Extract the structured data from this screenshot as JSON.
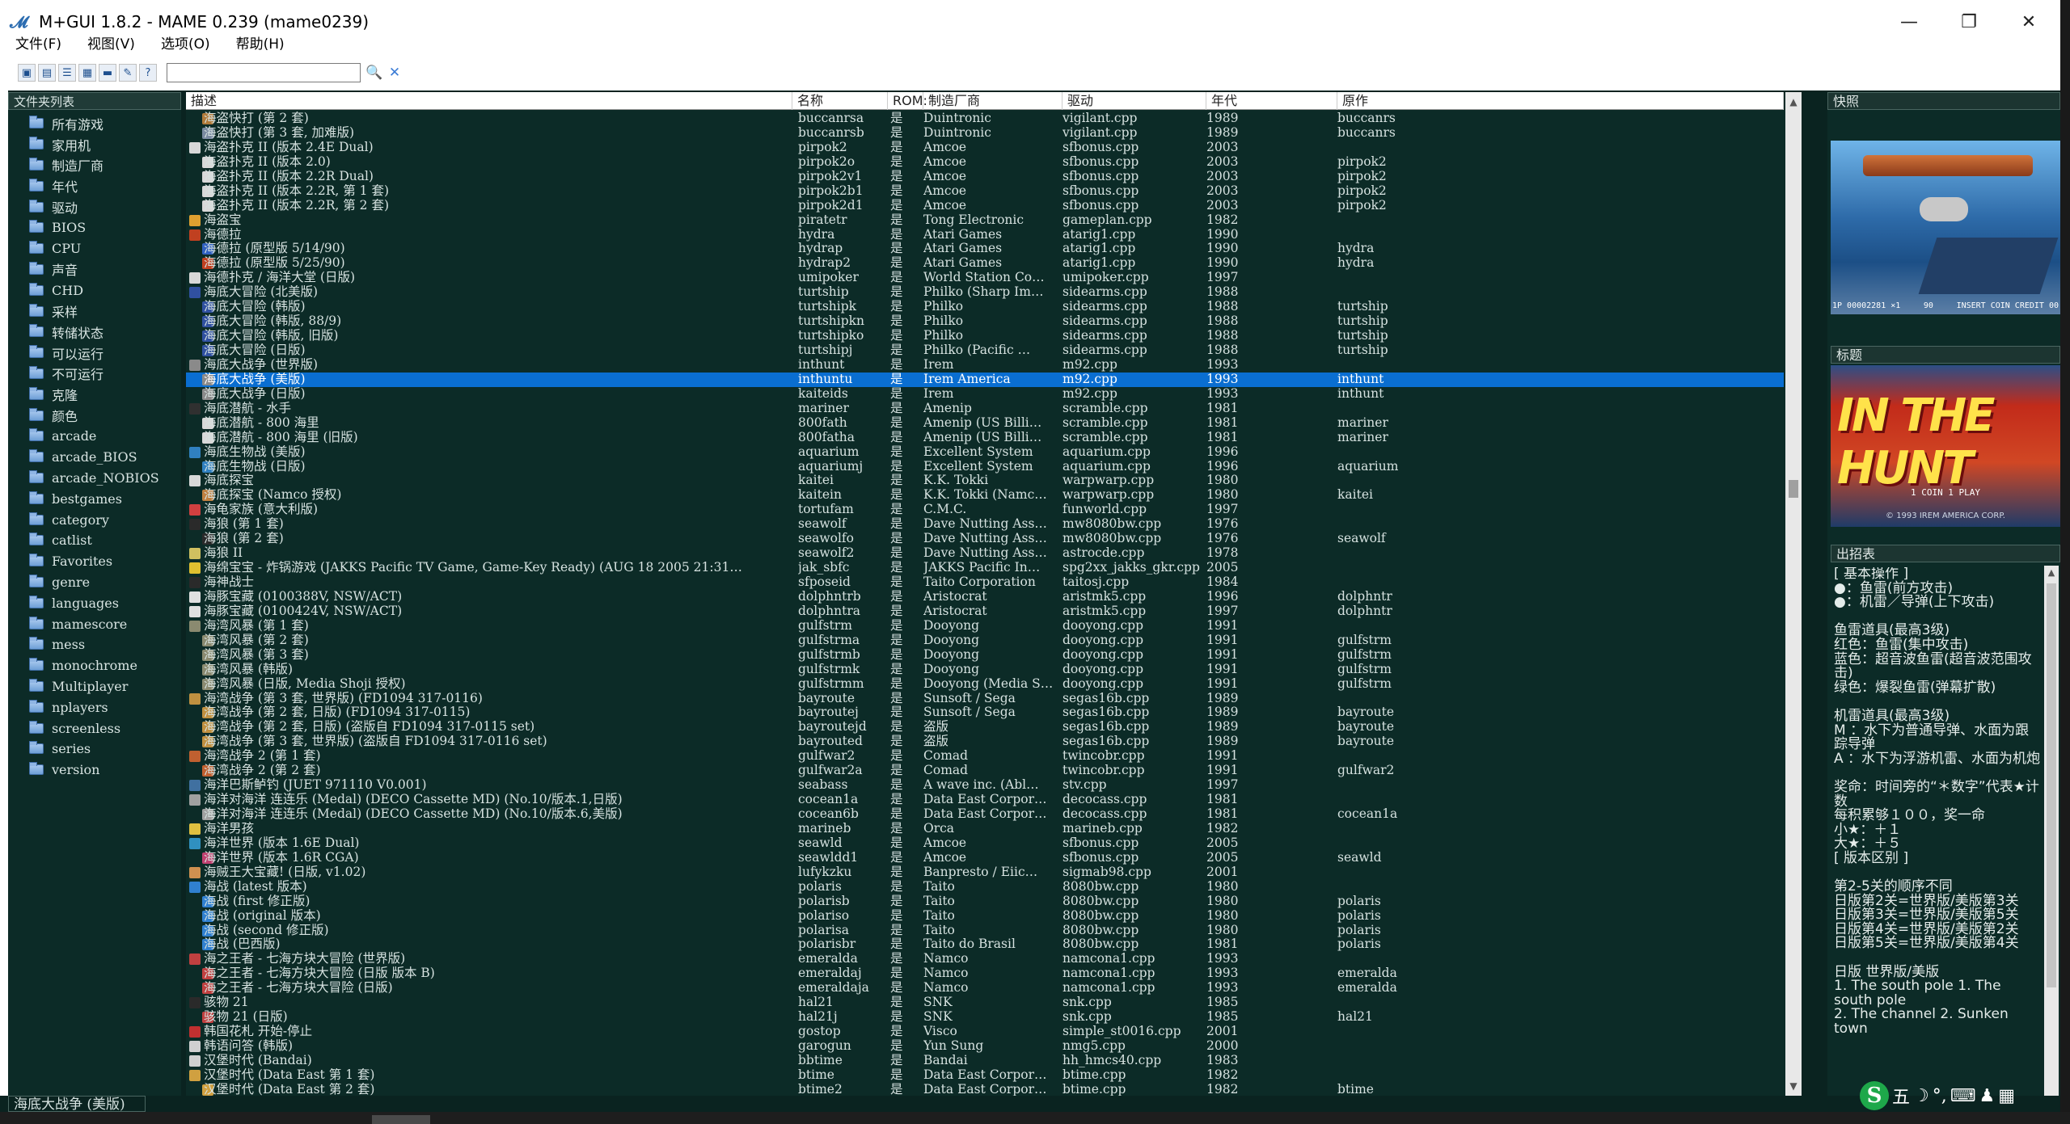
{
  "window": {
    "title": "M+GUI 1.8.2 - MAME 0.239 (mame0239)",
    "controls": {
      "minimize": "—",
      "maximize": "❐",
      "close": "✕"
    }
  },
  "menu": [
    "文件(F)",
    "视图(V)",
    "选项(O)",
    "帮助(H)"
  ],
  "toolbar": {
    "buttons": [
      "view-large-icons",
      "view-small-icons",
      "view-list",
      "view-details",
      "folder",
      "tools",
      "help"
    ],
    "search_value": "",
    "search_icon": "🔍",
    "clear_icon": "✕"
  },
  "folders": {
    "header": "文件夹列表",
    "items": [
      "所有游戏",
      "家用机",
      "制造厂商",
      "年代",
      "驱动",
      "BIOS",
      "CPU",
      "声音",
      "CHD",
      "采样",
      "转储状态",
      "可以运行",
      "不可运行",
      "克隆",
      "颜色",
      "arcade",
      "arcade_BIOS",
      "arcade_NOBIOS",
      "bestgames",
      "category",
      "catlist",
      "Favorites",
      "genre",
      "languages",
      "mamescore",
      "mess",
      "monochrome",
      "Multiplayer",
      "nplayers",
      "screenless",
      "series",
      "version"
    ]
  },
  "columns": {
    "desc": "描述",
    "name": "名称",
    "rom": "ROM:",
    "manu": "制造厂商",
    "driver": "驱动",
    "year": "年代",
    "parent": "原作"
  },
  "rows": [
    {
      "d": "　海盗快打 (第 2 套)",
      "n": "buccanrsa",
      "r": "是",
      "m": "Duintronic",
      "v": "vigilant.cpp",
      "y": "1989",
      "p": "buccanrs",
      "c": "#b07a3a"
    },
    {
      "d": "　海盗快打 (第 3 套, 加难版)",
      "n": "buccanrsb",
      "r": "是",
      "m": "Duintronic",
      "v": "vigilant.cpp",
      "y": "1989",
      "p": "buccanrs",
      "c": "#7a8aa0"
    },
    {
      "d": "海盗扑克 II (版本 2.4E Dual)",
      "n": "pirpok2",
      "r": "是",
      "m": "Amcoe",
      "v": "sfbonus.cpp",
      "y": "2003",
      "p": "",
      "c": "#d8d8d8"
    },
    {
      "d": "　海盗扑克 II (版本 2.0)",
      "n": "pirpok2o",
      "r": "是",
      "m": "Amcoe",
      "v": "sfbonus.cpp",
      "y": "2003",
      "p": "pirpok2",
      "c": "#d8d8d8"
    },
    {
      "d": "　海盗扑克 II (版本 2.2R Dual)",
      "n": "pirpok2v1",
      "r": "是",
      "m": "Amcoe",
      "v": "sfbonus.cpp",
      "y": "2003",
      "p": "pirpok2",
      "c": "#d8d8d8"
    },
    {
      "d": "　海盗扑克 II (版本 2.2R, 第 1 套)",
      "n": "pirpok2b1",
      "r": "是",
      "m": "Amcoe",
      "v": "sfbonus.cpp",
      "y": "2003",
      "p": "pirpok2",
      "c": "#d8d8d8"
    },
    {
      "d": "　海盗扑克 II (版本 2.2R, 第 2 套)",
      "n": "pirpok2d1",
      "r": "是",
      "m": "Amcoe",
      "v": "sfbonus.cpp",
      "y": "2003",
      "p": "pirpok2",
      "c": "#d8d8d8"
    },
    {
      "d": "海盗宝",
      "n": "piratetr",
      "r": "是",
      "m": "Tong Electronic",
      "v": "gameplan.cpp",
      "y": "1982",
      "p": "",
      "c": "#e0a030"
    },
    {
      "d": "海德拉",
      "n": "hydra",
      "r": "是",
      "m": "Atari Games",
      "v": "atarig1.cpp",
      "y": "1990",
      "p": "",
      "c": "#c04020"
    },
    {
      "d": "　海德拉 (原型版 5/14/90)",
      "n": "hydrap",
      "r": "是",
      "m": "Atari Games",
      "v": "atarig1.cpp",
      "y": "1990",
      "p": "hydra",
      "c": "#3060c0"
    },
    {
      "d": "　海德拉 (原型版 5/25/90)",
      "n": "hydrap2",
      "r": "是",
      "m": "Atari Games",
      "v": "atarig1.cpp",
      "y": "1990",
      "p": "hydra",
      "c": "#c04020"
    },
    {
      "d": "海德扑克 / 海洋大堂 (日版)",
      "n": "umipoker",
      "r": "是",
      "m": "World Station Co…",
      "v": "umipoker.cpp",
      "y": "1997",
      "p": "",
      "c": "#d8d8d8"
    },
    {
      "d": "海底大冒险 (北美版)",
      "n": "turtship",
      "r": "是",
      "m": "Philko (Sharp Im…",
      "v": "sidearms.cpp",
      "y": "1988",
      "p": "",
      "c": "#3050a0"
    },
    {
      "d": "　海底大冒险 (韩版)",
      "n": "turtshipk",
      "r": "是",
      "m": "Philko",
      "v": "sidearms.cpp",
      "y": "1988",
      "p": "turtship",
      "c": "#3050a0"
    },
    {
      "d": "　海底大冒险 (韩版, 88/9)",
      "n": "turtshipkn",
      "r": "是",
      "m": "Philko",
      "v": "sidearms.cpp",
      "y": "1988",
      "p": "turtship",
      "c": "#3050a0"
    },
    {
      "d": "　海底大冒险 (韩版, 旧版)",
      "n": "turtshipko",
      "r": "是",
      "m": "Philko",
      "v": "sidearms.cpp",
      "y": "1988",
      "p": "turtship",
      "c": "#3050a0"
    },
    {
      "d": "　海底大冒险 (日版)",
      "n": "turtshipj",
      "r": "是",
      "m": "Philko (Pacific …",
      "v": "sidearms.cpp",
      "y": "1988",
      "p": "turtship",
      "c": "#3050a0"
    },
    {
      "d": "海底大战争 (世界版)",
      "n": "inthunt",
      "r": "是",
      "m": "Irem",
      "v": "m92.cpp",
      "y": "1993",
      "p": "",
      "c": "#8a8a8a"
    },
    {
      "d": "　海底大战争 (美版)",
      "n": "inthuntu",
      "r": "是",
      "m": "Irem America",
      "v": "m92.cpp",
      "y": "1993",
      "p": "inthunt",
      "c": "#8a8a8a",
      "sel": true
    },
    {
      "d": "　海底大战争 (日版)",
      "n": "kaiteids",
      "r": "是",
      "m": "Irem",
      "v": "m92.cpp",
      "y": "1993",
      "p": "inthunt",
      "c": "#8a8a8a"
    },
    {
      "d": "海底潜航 - 水手",
      "n": "mariner",
      "r": "是",
      "m": "Amenip",
      "v": "scramble.cpp",
      "y": "1981",
      "p": "",
      "c": "#303030"
    },
    {
      "d": "　海底潜航 - 800 海里",
      "n": "800fath",
      "r": "是",
      "m": "Amenip (US Billi…",
      "v": "scramble.cpp",
      "y": "1981",
      "p": "mariner",
      "c": "#d8d8d8"
    },
    {
      "d": "　海底潜航 - 800 海里 (旧版)",
      "n": "800fatha",
      "r": "是",
      "m": "Amenip (US Billi…",
      "v": "scramble.cpp",
      "y": "1981",
      "p": "mariner",
      "c": "#d8d8d8"
    },
    {
      "d": "海底生物战 (美版)",
      "n": "aquarium",
      "r": "是",
      "m": "Excellent System",
      "v": "aquarium.cpp",
      "y": "1996",
      "p": "",
      "c": "#3080c0"
    },
    {
      "d": "　海底生物战 (日版)",
      "n": "aquariumj",
      "r": "是",
      "m": "Excellent System",
      "v": "aquarium.cpp",
      "y": "1996",
      "p": "aquarium",
      "c": "#3080c0"
    },
    {
      "d": "海底探宝",
      "n": "kaitei",
      "r": "是",
      "m": "K.K. Tokki",
      "v": "warpwarp.cpp",
      "y": "1980",
      "p": "",
      "c": "#d8d8d8"
    },
    {
      "d": "　海底探宝 (Namco 授权)",
      "n": "kaitein",
      "r": "是",
      "m": "K.K. Tokki (Namc…",
      "v": "warpwarp.cpp",
      "y": "1980",
      "p": "kaitei",
      "c": "#c08040"
    },
    {
      "d": "海龟家族 (意大利版)",
      "n": "tortufam",
      "r": "是",
      "m": "C.M.C.",
      "v": "funworld.cpp",
      "y": "1997",
      "p": "",
      "c": "#d04040"
    },
    {
      "d": "海狼 (第 1 套)",
      "n": "seawolf",
      "r": "是",
      "m": "Dave Nutting Ass…",
      "v": "mw8080bw.cpp",
      "y": "1976",
      "p": "",
      "c": "#2a2a2a"
    },
    {
      "d": "　海狼 (第 2 套)",
      "n": "seawolfo",
      "r": "是",
      "m": "Dave Nutting Ass…",
      "v": "mw8080bw.cpp",
      "y": "1976",
      "p": "seawolf",
      "c": "#2a2a2a"
    },
    {
      "d": "海狼 II",
      "n": "seawolf2",
      "r": "是",
      "m": "Dave Nutting Ass…",
      "v": "astrocde.cpp",
      "y": "1978",
      "p": "",
      "c": "#d0c060"
    },
    {
      "d": "海绵宝宝 - 炸锅游戏 (JAKKS Pacific TV Game, Game-Key Ready) (AUG 18 2005 21:31…",
      "n": "jak_sbfc",
      "r": "是",
      "m": "JAKKS Pacific In…",
      "v": "spg2xx_jakks_gkr.cpp",
      "y": "2005",
      "p": "",
      "c": "#e0c030"
    },
    {
      "d": "海神战士",
      "n": "sfposeid",
      "r": "是",
      "m": "Taito Corporation",
      "v": "taitosj.cpp",
      "y": "1984",
      "p": "",
      "c": "#2a2a2a"
    },
    {
      "d": "海豚宝藏 (0100388V, NSW/ACT)",
      "n": "dolphntrb",
      "r": "是",
      "m": "Aristocrat",
      "v": "aristmk5.cpp",
      "y": "1996",
      "p": "dolphntr",
      "c": "#e0e0e0"
    },
    {
      "d": "海豚宝藏 (0100424V, NSW/ACT)",
      "n": "dolphntra",
      "r": "是",
      "m": "Aristocrat",
      "v": "aristmk5.cpp",
      "y": "1997",
      "p": "dolphntr",
      "c": "#e0e0e0"
    },
    {
      "d": "海湾风暴 (第 1 套)",
      "n": "gulfstrm",
      "r": "是",
      "m": "Dooyong",
      "v": "dooyong.cpp",
      "y": "1991",
      "p": "",
      "c": "#8a8a70"
    },
    {
      "d": "　海湾风暴 (第 2 套)",
      "n": "gulfstrma",
      "r": "是",
      "m": "Dooyong",
      "v": "dooyong.cpp",
      "y": "1991",
      "p": "gulfstrm",
      "c": "#8a8a70"
    },
    {
      "d": "　海湾风暴 (第 3 套)",
      "n": "gulfstrmb",
      "r": "是",
      "m": "Dooyong",
      "v": "dooyong.cpp",
      "y": "1991",
      "p": "gulfstrm",
      "c": "#8a8a70"
    },
    {
      "d": "　海湾风暴 (韩版)",
      "n": "gulfstrmk",
      "r": "是",
      "m": "Dooyong",
      "v": "dooyong.cpp",
      "y": "1991",
      "p": "gulfstrm",
      "c": "#8a8a70"
    },
    {
      "d": "　海湾风暴 (日版, Media Shoji 授权)",
      "n": "gulfstrmm",
      "r": "是",
      "m": "Dooyong (Media S…",
      "v": "dooyong.cpp",
      "y": "1991",
      "p": "gulfstrm",
      "c": "#8a8a70"
    },
    {
      "d": "海湾战争 (第 3 套, 世界版) (FD1094 317-0116)",
      "n": "bayroute",
      "r": "是",
      "m": "Sunsoft / Sega",
      "v": "segas16b.cpp",
      "y": "1989",
      "p": "",
      "c": "#c09040"
    },
    {
      "d": "　海湾战争 (第 2 套, 日版) (FD1094 317-0115)",
      "n": "bayroutej",
      "r": "是",
      "m": "Sunsoft / Sega",
      "v": "segas16b.cpp",
      "y": "1989",
      "p": "bayroute",
      "c": "#c09040"
    },
    {
      "d": "　海湾战争 (第 2 套, 日版) (盗版自 FD1094 317-0115 set)",
      "n": "bayroutejd",
      "r": "是",
      "m": "盗版",
      "v": "segas16b.cpp",
      "y": "1989",
      "p": "bayroute",
      "c": "#c09040"
    },
    {
      "d": "　海湾战争 (第 3 套, 世界版) (盗版自 FD1094 317-0116 set)",
      "n": "bayrouted",
      "r": "是",
      "m": "盗版",
      "v": "segas16b.cpp",
      "y": "1989",
      "p": "bayroute",
      "c": "#c09040"
    },
    {
      "d": "海湾战争 2 (第 1 套)",
      "n": "gulfwar2",
      "r": "是",
      "m": "Comad",
      "v": "twincobr.cpp",
      "y": "1991",
      "p": "",
      "c": "#c06030"
    },
    {
      "d": "　海湾战争 2 (第 2 套)",
      "n": "gulfwar2a",
      "r": "是",
      "m": "Comad",
      "v": "twincobr.cpp",
      "y": "1991",
      "p": "gulfwar2",
      "c": "#c06030"
    },
    {
      "d": "海洋巴斯鲈钓 (JUET 971110 V0.001)",
      "n": "seabass",
      "r": "是",
      "m": "A wave inc. (Abl…",
      "v": "stv.cpp",
      "y": "1997",
      "p": "",
      "c": "#4070a0"
    },
    {
      "d": "海洋对海洋 连连乐 (Medal) (DECO Cassette MD) (No.10/版本.1,日版)",
      "n": "cocean1a",
      "r": "是",
      "m": "Data East Corpor…",
      "v": "decocass.cpp",
      "y": "1981",
      "p": "",
      "c": "#a0a0a0"
    },
    {
      "d": "　海洋对海洋 连连乐 (Medal) (DECO Cassette MD) (No.10/版本.6,美版)",
      "n": "cocean6b",
      "r": "是",
      "m": "Data East Corpor…",
      "v": "decocass.cpp",
      "y": "1981",
      "p": "cocean1a",
      "c": "#a0a0a0"
    },
    {
      "d": "海洋男孩",
      "n": "marineb",
      "r": "是",
      "m": "Orca",
      "v": "marineb.cpp",
      "y": "1982",
      "p": "",
      "c": "#e0c040"
    },
    {
      "d": "海洋世界 (版本 1.6E Dual)",
      "n": "seawld",
      "r": "是",
      "m": "Amcoe",
      "v": "sfbonus.cpp",
      "y": "2005",
      "p": "",
      "c": "#3090c0"
    },
    {
      "d": "　海洋世界 (版本 1.6R CGA)",
      "n": "seawldd1",
      "r": "是",
      "m": "Amcoe",
      "v": "sfbonus.cpp",
      "y": "2005",
      "p": "seawld",
      "c": "#c04070"
    },
    {
      "d": "海贼王大宝藏! (日版, v1.02)",
      "n": "lufykzku",
      "r": "是",
      "m": "Banpresto / Eiic…",
      "v": "sigmab98.cpp",
      "y": "2001",
      "p": "",
      "c": "#d09050"
    },
    {
      "d": "海战 (latest 版本)",
      "n": "polaris",
      "r": "是",
      "m": "Taito",
      "v": "8080bw.cpp",
      "y": "1980",
      "p": "",
      "c": "#3080d0"
    },
    {
      "d": "　海战 (first 修正版)",
      "n": "polarisb",
      "r": "是",
      "m": "Taito",
      "v": "8080bw.cpp",
      "y": "1980",
      "p": "polaris",
      "c": "#3080d0"
    },
    {
      "d": "　海战 (original 版本)",
      "n": "polariso",
      "r": "是",
      "m": "Taito",
      "v": "8080bw.cpp",
      "y": "1980",
      "p": "polaris",
      "c": "#3080d0"
    },
    {
      "d": "　海战 (second 修正版)",
      "n": "polarisa",
      "r": "是",
      "m": "Taito",
      "v": "8080bw.cpp",
      "y": "1980",
      "p": "polaris",
      "c": "#3080d0"
    },
    {
      "d": "　海战 (巴西版)",
      "n": "polarisbr",
      "r": "是",
      "m": "Taito do Brasil",
      "v": "8080bw.cpp",
      "y": "1981",
      "p": "polaris",
      "c": "#3080d0"
    },
    {
      "d": "海之王者 - 七海方块大冒险 (世界版)",
      "n": "emeralda",
      "r": "是",
      "m": "Namco",
      "v": "namcona1.cpp",
      "y": "1993",
      "p": "",
      "c": "#c04040"
    },
    {
      "d": "　海之王者 - 七海方块大冒险 (日版 版本 B)",
      "n": "emeraldaj",
      "r": "是",
      "m": "Namco",
      "v": "namcona1.cpp",
      "y": "1993",
      "p": "emeralda",
      "c": "#c04040"
    },
    {
      "d": "　海之王者 - 七海方块大冒险 (日版)",
      "n": "emeraldaja",
      "r": "是",
      "m": "Namco",
      "v": "namcona1.cpp",
      "y": "1993",
      "p": "emeralda",
      "c": "#c04040"
    },
    {
      "d": "骇物 21",
      "n": "hal21",
      "r": "是",
      "m": "SNK",
      "v": "snk.cpp",
      "y": "1985",
      "p": "",
      "c": "#2a2a2a"
    },
    {
      "d": "　骇物 21 (日版)",
      "n": "hal21j",
      "r": "是",
      "m": "SNK",
      "v": "snk.cpp",
      "y": "1985",
      "p": "hal21",
      "c": "#c04040"
    },
    {
      "d": "韩国花札 开始-停止",
      "n": "gostop",
      "r": "是",
      "m": "Visco",
      "v": "simple_st0016.cpp",
      "y": "2001",
      "p": "",
      "c": "#c03030"
    },
    {
      "d": "韩语问答 (韩版)",
      "n": "garogun",
      "r": "是",
      "m": "Yun Sung",
      "v": "nmg5.cpp",
      "y": "2000",
      "p": "",
      "c": "#d0d0d0"
    },
    {
      "d": "汉堡时代 (Bandai)",
      "n": "bbtime",
      "r": "是",
      "m": "Bandai",
      "v": "hh_hmcs40.cpp",
      "y": "1983",
      "p": "",
      "c": "#d0d0d0"
    },
    {
      "d": "汉堡时代 (Data East 第 1 套)",
      "n": "btime",
      "r": "是",
      "m": "Data East Corpor…",
      "v": "btime.cpp",
      "y": "1982",
      "p": "",
      "c": "#d0a040"
    },
    {
      "d": "　汉堡时代 (Data East 第 2 套)",
      "n": "btime2",
      "r": "是",
      "m": "Data East Corpor…",
      "v": "btime.cpp",
      "y": "1982",
      "p": "btime",
      "c": "#d0a040"
    }
  ],
  "right": {
    "snap_header": "快照",
    "snap_hud_left": "1P 00002281 ×1",
    "snap_hud_mid": "90",
    "snap_hud_right": "INSERT COIN CREDIT 00",
    "title_header": "标题",
    "title_logo": "IN THE HUNT",
    "title_credit": "1 COIN  1 PLAY",
    "title_copyright": "© 1993 IREM AMERICA CORP.",
    "moves_header": "出招表",
    "moves_text": "[ 基本操作 ]\n●：鱼雷(前方攻击)\n●：机雷／导弹(上下攻击)\n\n鱼雷道具(最高3级)\n红色：鱼雷(集中攻击)\n蓝色：超音波鱼雷(超音波范围攻击)\n绿色：爆裂鱼雷(弹幕扩散)\n\n机雷道具(最高3级)\nM ：水下为普通导弹、水面为跟踪导弹\nA ：水下为浮游机雷、水面为机炮\n\n奖命：时间旁的“＊数字”代表★计数\n每积累够１００，奖一命\n小★：＋１\n大★：＋５\n[ 版本区别 ]\n\n第2-5关的顺序不同\n日版第2关=世界版/美版第3关\n日版第3关=世界版/美版第5关\n日版第4关=世界版/美版第2关\n日版第5关=世界版/美版第4关\n\n日版 世界版/美版\n1. The south pole 1. The south pole\n2. The channel 2. Sunken town"
  },
  "status": {
    "selected": "海底大战争 (美版)",
    "ime": [
      "S",
      "五",
      "☽",
      "°,",
      "⌨",
      "♟",
      "▦"
    ]
  }
}
